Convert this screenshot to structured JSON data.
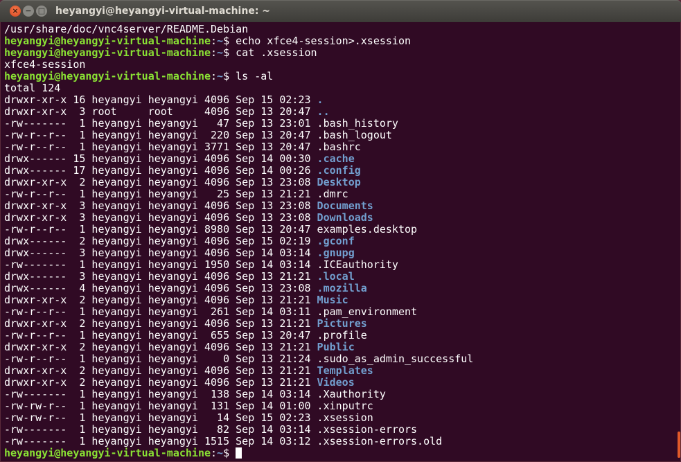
{
  "window": {
    "title": "heyangyi@heyangyi-virtual-machine: ~",
    "buttons": {
      "close": "×",
      "minimize": "−",
      "maximize": "□"
    }
  },
  "colors": {
    "background": "#300a24",
    "prompt": "#8ae234",
    "directory": "#729fcf",
    "text": "#ffffff",
    "scroll_thumb": "#e05a2a"
  },
  "prompt": {
    "user_host": "heyangyi@heyangyi-virtual-machine",
    "colon": ":",
    "path": "~",
    "dollar": "$"
  },
  "history": [
    {
      "type": "output",
      "text": "/usr/share/doc/vnc4server/README.Debian"
    },
    {
      "type": "command",
      "text": " echo xfce4-session>.xsession"
    },
    {
      "type": "command",
      "text": " cat .xsession"
    },
    {
      "type": "output",
      "text": "xfce4-session"
    },
    {
      "type": "command",
      "text": " ls -al"
    },
    {
      "type": "output",
      "text": "total 124"
    }
  ],
  "listing": [
    {
      "meta": "drwxr-xr-x 16 heyangyi heyangyi 4096 Sep 15 02:23 ",
      "name": ".",
      "dir": true
    },
    {
      "meta": "drwxr-xr-x  3 root     root     4096 Sep 13 20:47 ",
      "name": "..",
      "dir": true
    },
    {
      "meta": "-rw-------  1 heyangyi heyangyi   47 Sep 13 23:01 ",
      "name": ".bash_history",
      "dir": false
    },
    {
      "meta": "-rw-r--r--  1 heyangyi heyangyi  220 Sep 13 20:47 ",
      "name": ".bash_logout",
      "dir": false
    },
    {
      "meta": "-rw-r--r--  1 heyangyi heyangyi 3771 Sep 13 20:47 ",
      "name": ".bashrc",
      "dir": false
    },
    {
      "meta": "drwx------ 15 heyangyi heyangyi 4096 Sep 14 00:30 ",
      "name": ".cache",
      "dir": true
    },
    {
      "meta": "drwx------ 17 heyangyi heyangyi 4096 Sep 14 00:26 ",
      "name": ".config",
      "dir": true
    },
    {
      "meta": "drwxr-xr-x  2 heyangyi heyangyi 4096 Sep 13 23:08 ",
      "name": "Desktop",
      "dir": true
    },
    {
      "meta": "-rw-r--r--  1 heyangyi heyangyi   25 Sep 13 21:21 ",
      "name": ".dmrc",
      "dir": false
    },
    {
      "meta": "drwxr-xr-x  3 heyangyi heyangyi 4096 Sep 13 23:08 ",
      "name": "Documents",
      "dir": true
    },
    {
      "meta": "drwxr-xr-x  3 heyangyi heyangyi 4096 Sep 13 23:08 ",
      "name": "Downloads",
      "dir": true
    },
    {
      "meta": "-rw-r--r--  1 heyangyi heyangyi 8980 Sep 13 20:47 ",
      "name": "examples.desktop",
      "dir": false
    },
    {
      "meta": "drwx------  2 heyangyi heyangyi 4096 Sep 15 02:19 ",
      "name": ".gconf",
      "dir": true
    },
    {
      "meta": "drwx------  3 heyangyi heyangyi 4096 Sep 14 03:14 ",
      "name": ".gnupg",
      "dir": true
    },
    {
      "meta": "-rw-------  1 heyangyi heyangyi 1950 Sep 14 03:14 ",
      "name": ".ICEauthority",
      "dir": false
    },
    {
      "meta": "drwx------  3 heyangyi heyangyi 4096 Sep 13 21:21 ",
      "name": ".local",
      "dir": true
    },
    {
      "meta": "drwx------  4 heyangyi heyangyi 4096 Sep 13 23:08 ",
      "name": ".mozilla",
      "dir": true
    },
    {
      "meta": "drwxr-xr-x  2 heyangyi heyangyi 4096 Sep 13 21:21 ",
      "name": "Music",
      "dir": true
    },
    {
      "meta": "-rw-r--r--  1 heyangyi heyangyi  261 Sep 14 03:11 ",
      "name": ".pam_environment",
      "dir": false
    },
    {
      "meta": "drwxr-xr-x  2 heyangyi heyangyi 4096 Sep 13 21:21 ",
      "name": "Pictures",
      "dir": true
    },
    {
      "meta": "-rw-r--r--  1 heyangyi heyangyi  655 Sep 13 20:47 ",
      "name": ".profile",
      "dir": false
    },
    {
      "meta": "drwxr-xr-x  2 heyangyi heyangyi 4096 Sep 13 21:21 ",
      "name": "Public",
      "dir": true
    },
    {
      "meta": "-rw-r--r--  1 heyangyi heyangyi    0 Sep 13 21:24 ",
      "name": ".sudo_as_admin_successful",
      "dir": false
    },
    {
      "meta": "drwxr-xr-x  2 heyangyi heyangyi 4096 Sep 13 21:21 ",
      "name": "Templates",
      "dir": true
    },
    {
      "meta": "drwxr-xr-x  2 heyangyi heyangyi 4096 Sep 13 21:21 ",
      "name": "Videos",
      "dir": true
    },
    {
      "meta": "-rw-------  1 heyangyi heyangyi  138 Sep 14 03:14 ",
      "name": ".Xauthority",
      "dir": false
    },
    {
      "meta": "-rw-rw-r--  1 heyangyi heyangyi  131 Sep 14 01:00 ",
      "name": ".xinputrc",
      "dir": false
    },
    {
      "meta": "-rw-rw-r--  1 heyangyi heyangyi   14 Sep 15 02:23 ",
      "name": ".xsession",
      "dir": false
    },
    {
      "meta": "-rw-------  1 heyangyi heyangyi   82 Sep 14 03:14 ",
      "name": ".xsession-errors",
      "dir": false
    },
    {
      "meta": "-rw-------  1 heyangyi heyangyi 1515 Sep 14 03:12 ",
      "name": ".xsession-errors.old",
      "dir": false
    }
  ],
  "current_input": " "
}
